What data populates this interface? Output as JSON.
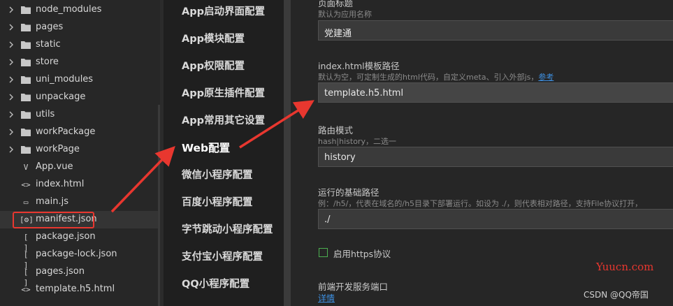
{
  "file_tree": {
    "items": [
      {
        "label": "node_modules",
        "type": "folder",
        "icon": "folder-icon"
      },
      {
        "label": "pages",
        "type": "folder",
        "icon": "folder-icon"
      },
      {
        "label": "static",
        "type": "folder",
        "icon": "folder-icon"
      },
      {
        "label": "store",
        "type": "folder",
        "icon": "folder-icon"
      },
      {
        "label": "uni_modules",
        "type": "folder",
        "icon": "folder-icon"
      },
      {
        "label": "unpackage",
        "type": "folder",
        "icon": "folder-icon"
      },
      {
        "label": "utils",
        "type": "folder",
        "icon": "folder-icon"
      },
      {
        "label": "workPackage",
        "type": "folder",
        "icon": "folder-icon"
      },
      {
        "label": "workPage",
        "type": "folder",
        "icon": "folder-icon"
      },
      {
        "label": "App.vue",
        "type": "file",
        "icon": "vue-file-icon",
        "glyph": "V"
      },
      {
        "label": "index.html",
        "type": "file",
        "icon": "html-file-icon",
        "glyph": "<>"
      },
      {
        "label": "main.js",
        "type": "file",
        "icon": "js-file-icon",
        "glyph": "▭"
      },
      {
        "label": "manifest.json",
        "type": "file",
        "icon": "manifest-file-icon",
        "glyph": "[⚙]",
        "selected": true
      },
      {
        "label": "package.json",
        "type": "file",
        "icon": "json-file-icon",
        "glyph": "[ ]"
      },
      {
        "label": "package-lock.json",
        "type": "file",
        "icon": "json-file-icon",
        "glyph": "[ ]"
      },
      {
        "label": "pages.json",
        "type": "file",
        "icon": "json-file-icon",
        "glyph": "[ ]"
      },
      {
        "label": "template.h5.html",
        "type": "file",
        "icon": "html-file-icon",
        "glyph": "<>"
      }
    ]
  },
  "settings_nav": {
    "items": [
      {
        "label": "App启动界面配置"
      },
      {
        "label": "App模块配置"
      },
      {
        "label": "App权限配置"
      },
      {
        "label": "App原生插件配置"
      },
      {
        "label": "App常用其它设置"
      },
      {
        "label": "Web配置",
        "active": true
      },
      {
        "label": "微信小程序配置"
      },
      {
        "label": "百度小程序配置"
      },
      {
        "label": "字节跳动小程序配置"
      },
      {
        "label": "支付宝小程序配置"
      },
      {
        "label": "QQ小程序配置"
      }
    ]
  },
  "form": {
    "page_title_label": "页面标题",
    "page_title_hint": "默认为应用名称",
    "page_title_value": "党建通",
    "template_label": "index.html模板路径",
    "template_hint": "默认为空，可定制生成的html代码，自定义meta、引入外部js，",
    "template_hint_link": "参考",
    "template_value": "template.h5.html",
    "router_label": "路由模式",
    "router_hint": "hash|history，二选一",
    "router_value": "history",
    "base_label": "运行的基础路径",
    "base_hint": "例：/h5/，代表在域名的/h5目录下部署运行。如设为 ./，则代表相对路径，支持File协议打开，",
    "base_value": "./",
    "https_label": "启用https协议",
    "https_checked": false,
    "port_label": "前端开发服务端口",
    "port_link": "详情"
  },
  "watermarks": {
    "site": "Yuucn.com",
    "credit": "CSDN @QQ帝国"
  },
  "colors": {
    "annotation_red": "#e8372f",
    "link_blue": "#3d8fe0",
    "checkbox_green": "#4caf50"
  }
}
